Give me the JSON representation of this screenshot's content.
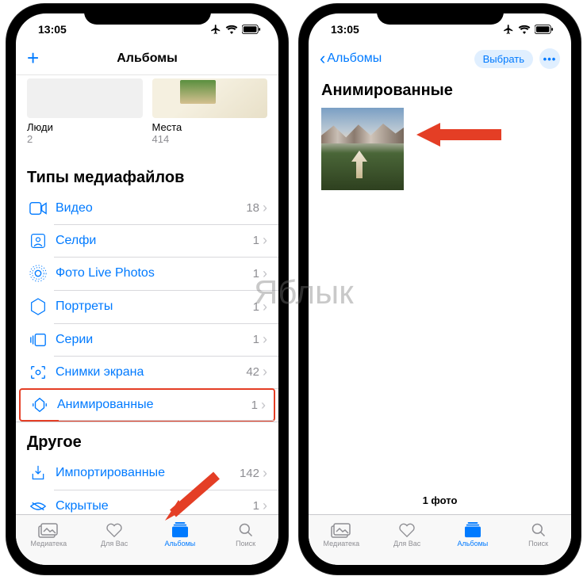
{
  "watermark": "Яблык",
  "status": {
    "time": "13:05"
  },
  "screen1": {
    "nav_title": "Альбомы",
    "albums": {
      "people": {
        "label": "Люди",
        "count": "2"
      },
      "places": {
        "label": "Места",
        "count": "414"
      }
    },
    "section_media": "Типы медиафайлов",
    "rows": [
      {
        "icon": "video-icon",
        "label": "Видео",
        "count": "18"
      },
      {
        "icon": "selfie-icon",
        "label": "Селфи",
        "count": "1"
      },
      {
        "icon": "livephoto-icon",
        "label": "Фото Live Photos",
        "count": "1"
      },
      {
        "icon": "portrait-icon",
        "label": "Портреты",
        "count": "1"
      },
      {
        "icon": "burst-icon",
        "label": "Серии",
        "count": "1"
      },
      {
        "icon": "screenshot-icon",
        "label": "Снимки экрана",
        "count": "42"
      },
      {
        "icon": "animated-icon",
        "label": "Анимированные",
        "count": "1"
      }
    ],
    "section_other": "Другое",
    "other_rows": [
      {
        "icon": "import-icon",
        "label": "Импортированные",
        "count": "142"
      },
      {
        "icon": "hidden-icon",
        "label": "Скрытые",
        "count": "1"
      }
    ]
  },
  "screen2": {
    "back_label": "Альбомы",
    "select_label": "Выбрать",
    "title": "Анимированные",
    "footer": "1 фото"
  },
  "tabs": [
    {
      "label": "Медиатека"
    },
    {
      "label": "Для Вас"
    },
    {
      "label": "Альбомы"
    },
    {
      "label": "Поиск"
    }
  ]
}
